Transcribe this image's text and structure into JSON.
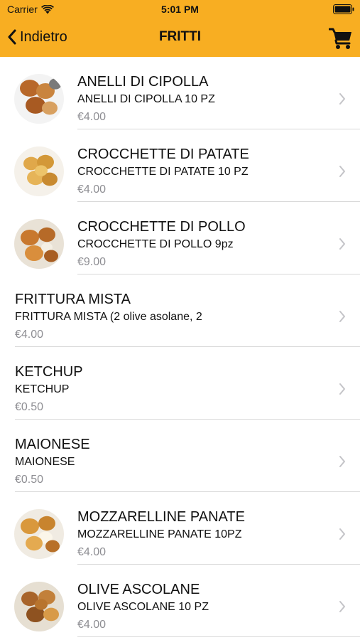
{
  "status": {
    "carrier": "Carrier",
    "time": "5:01 PM",
    "icons": [
      "wifi-icon",
      "battery-icon"
    ]
  },
  "nav": {
    "back_label": "Indietro",
    "title": "FRITTI",
    "cart_icon": "cart-icon"
  },
  "colors": {
    "header": "#F8AE22",
    "price": "#8e8e93",
    "divider": "#d8d8d8"
  },
  "products": [
    {
      "name": "ANELLI DI CIPOLLA",
      "description": "ANELLI DI CIPOLLA 10 PZ",
      "price": "€4.00",
      "has_image": true
    },
    {
      "name": "CROCCHETTE DI PATATE",
      "description": "CROCCHETTE DI PATATE 10 PZ",
      "price": "€4.00",
      "has_image": true
    },
    {
      "name": "CROCCHETTE DI POLLO",
      "description": "CROCCHETTE DI POLLO 9pz",
      "price": "€9.00",
      "has_image": true
    },
    {
      "name": "FRITTURA MISTA",
      "description": "FRITTURA MISTA (2 olive asolane, 2",
      "price": "€4.00",
      "has_image": false
    },
    {
      "name": "KETCHUP",
      "description": "KETCHUP",
      "price": "€0.50",
      "has_image": false
    },
    {
      "name": "MAIONESE",
      "description": "MAIONESE",
      "price": "€0.50",
      "has_image": false
    },
    {
      "name": "MOZZARELLINE PANATE",
      "description": "MOZZARELLINE PANATE 10PZ",
      "price": "€4.00",
      "has_image": true
    },
    {
      "name": "OLIVE ASCOLANE",
      "description": "OLIVE ASCOLANE 10 PZ",
      "price": "€4.00",
      "has_image": true
    }
  ]
}
